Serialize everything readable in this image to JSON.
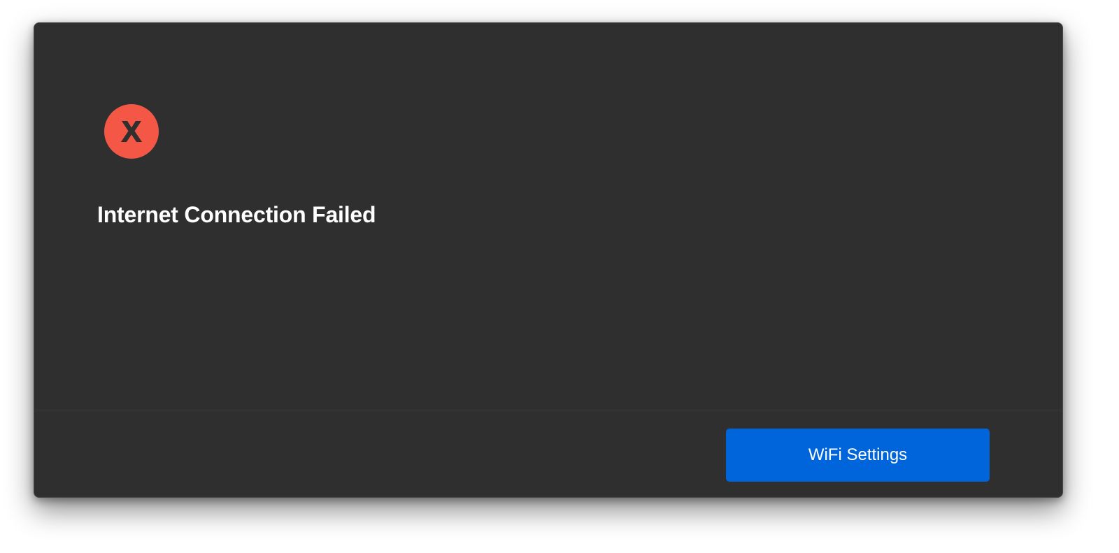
{
  "dialog": {
    "icon": "error-x-circle-icon",
    "icon_color": "#f45745",
    "background_color": "#2f2f2f",
    "title": "Internet Connection Failed"
  },
  "footer": {
    "primary_button_label": "WiFi Settings",
    "primary_button_color": "#0065db"
  }
}
